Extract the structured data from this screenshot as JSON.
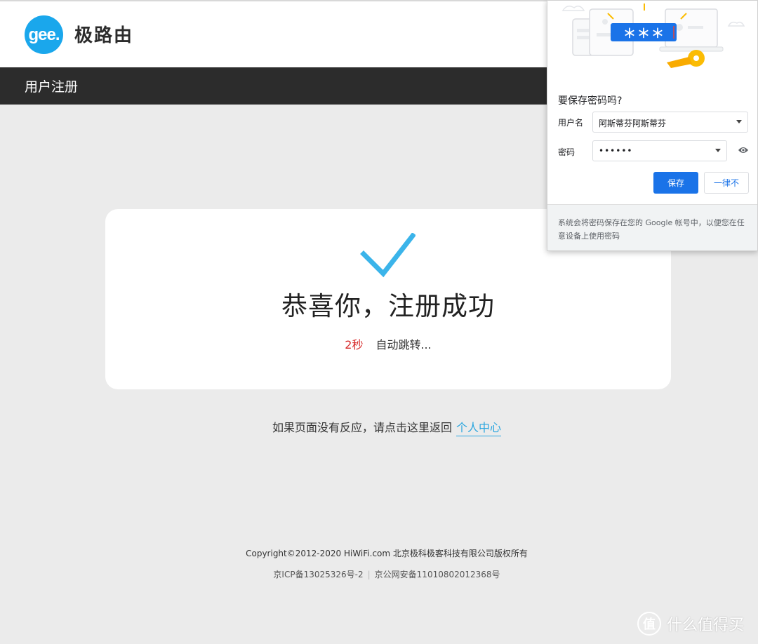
{
  "header": {
    "logo_text": "gee.",
    "brand_name": "极路由"
  },
  "subbar": {
    "title": "用户注册"
  },
  "result_card": {
    "title": "恭喜你，注册成功",
    "countdown": "2秒",
    "redirect_text": "自动跳转..."
  },
  "return_line": {
    "text": "如果页面没有反应，请点击这里返回",
    "link_label": "个人中心"
  },
  "footer": {
    "copyright": "Copyright©2012-2020 HiWiFi.com 北京极科极客科技有限公司版权所有",
    "icp": "京ICP备13025326号-2",
    "police": "京公网安备11010802012368号"
  },
  "watermark": {
    "icon_text": "值",
    "text": "什么值得买"
  },
  "save_password_popup": {
    "illustration_text": "＊＊＊",
    "title": "要保存密码吗?",
    "username_label": "用户名",
    "username_value": "阿斯蒂芬阿斯蒂芬",
    "password_label": "密码",
    "password_value": "••••••",
    "save_label": "保存",
    "never_label": "一律不",
    "footer_text": "系统会将密码保存在您的 Google 帐号中，以便您在任意设备上使用密码"
  },
  "colors": {
    "accent_blue": "#1aa7ec",
    "dark_bar": "#2c2c2c",
    "check_blue": "#3bb4ea",
    "countdown_red": "#d72c2c",
    "link_blue": "#2ba6df",
    "google_blue": "#1a73e8"
  }
}
